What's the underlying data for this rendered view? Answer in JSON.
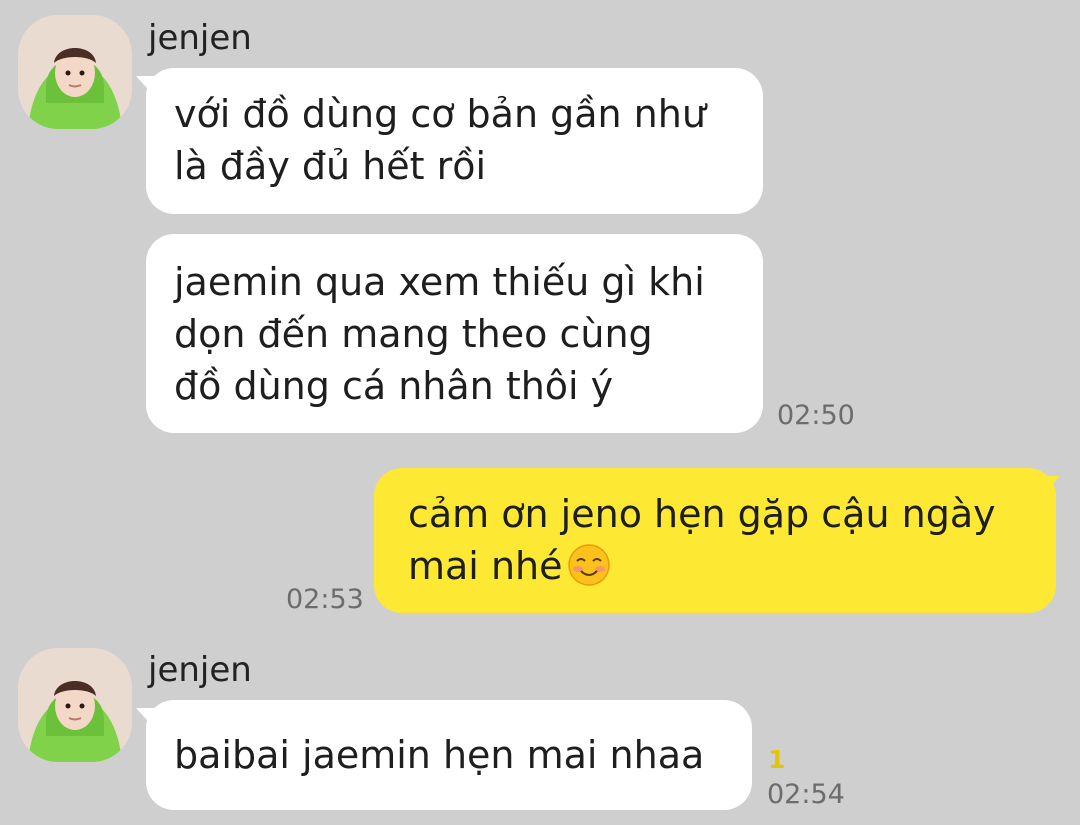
{
  "colors": {
    "background": "#cfcfcf",
    "incoming_bubble": "#ffffff",
    "outgoing_bubble": "#fde934",
    "timestamp": "#6c6c6c",
    "unread_count": "#e2c700"
  },
  "messages": {
    "group1": {
      "sender": "jenjen",
      "avatar_icon": "profile-photo-green-hoodie",
      "bubble1": {
        "line1": "với đồ dùng cơ bản gần như",
        "line2": "là đầy đủ hết rồi"
      },
      "bubble2": {
        "line1": "jaemin qua xem thiếu gì khi",
        "line2": "dọn đến mang theo cùng",
        "line3": "đồ dùng cá nhân thôi ý",
        "time": "02:50"
      }
    },
    "outgoing": {
      "line1": "cảm ơn jeno hẹn gặp cậu ngày",
      "line2": "mai nhé",
      "emoji_icon": "smiling-blushing-face-emoji",
      "time": "02:53"
    },
    "group2": {
      "sender": "jenjen",
      "avatar_icon": "profile-photo-green-hoodie",
      "bubble1": {
        "line1": "baibai jaemin hẹn mai nhaa",
        "unread": "1",
        "time": "02:54"
      }
    }
  }
}
